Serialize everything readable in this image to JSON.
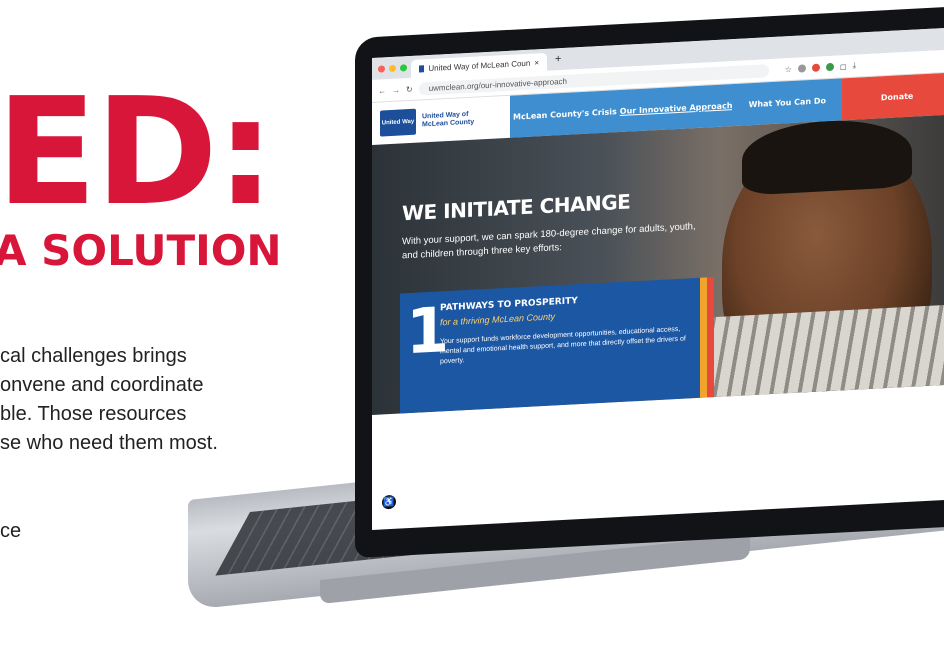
{
  "brochure": {
    "headline": "ED:",
    "subhead": "A SOLUTION",
    "body_lines": [
      "cal challenges brings",
      "onvene and coordinate",
      "ble. Those resources",
      "se who need them most."
    ],
    "trailing_text": "ce"
  },
  "browser": {
    "tab_title": "United Way of McLean Coun",
    "new_tab_label": "+",
    "url": "uwmclean.org/our-innovative-approach"
  },
  "site": {
    "logo_mark": "United Way",
    "logo_text": "United Way of McLean County",
    "nav": [
      {
        "label": "McLean County's Crisis"
      },
      {
        "label": "Our Innovative Approach"
      },
      {
        "label": "What You Can Do"
      },
      {
        "label": "Donate"
      }
    ],
    "hero": {
      "title": "WE INITIATE CHANGE",
      "text": "With your support, we can spark 180-degree change for adults, youth, and children through three key efforts:"
    },
    "card": {
      "number": "1",
      "title": "PATHWAYS TO PROSPERITY",
      "subtitle": "for a thriving McLean County",
      "body": "Your support funds workforce development opportunities, educational access, mental and emotional health support, and more that directly offset the drivers of poverty."
    }
  },
  "colors": {
    "brand_red": "#d8163a",
    "nav_blue": "#3f8fd0",
    "card_blue": "#1c57a3",
    "donate_red": "#e8493d"
  }
}
